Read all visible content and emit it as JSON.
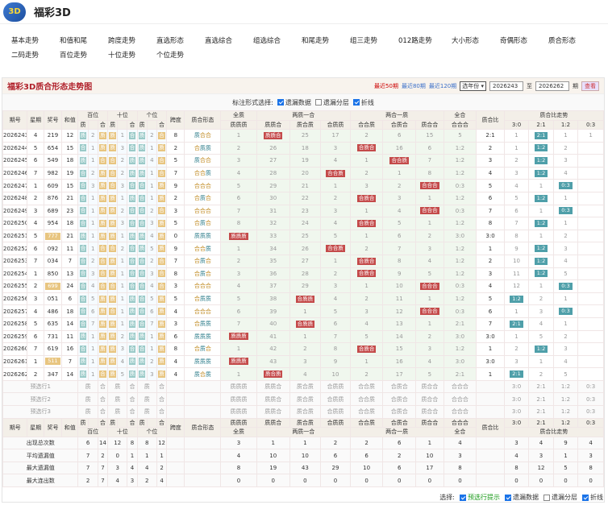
{
  "app": {
    "title": "福彩3D",
    "logo_icon": "fc3d-logo-icon"
  },
  "nav": [
    "基本走势",
    "和值和尾",
    "跨度走势",
    "直选形态",
    "直选综合",
    "组选综合",
    "和尾走势",
    "组三走势",
    "012路走势",
    "大小形态",
    "奇偶形态",
    "质合形态",
    "二码走势",
    "百位走势",
    "十位走势",
    "个位走势"
  ],
  "panel": {
    "title": "福彩3D质合形态走势图",
    "recent50": "最近50期",
    "recent80": "最近80期",
    "recent120": "最近120期",
    "year_select": "选年份",
    "from": "2026243",
    "to_label": "至",
    "to": "2026262",
    "period": "期",
    "query": "查看"
  },
  "options": {
    "label": "标注形式选择:",
    "items": [
      {
        "label": "遗漏数据",
        "checked": true
      },
      {
        "label": "遗漏分层",
        "checked": false
      },
      {
        "label": "折线",
        "checked": true
      }
    ]
  },
  "headers": {
    "qh": "期号",
    "xq": "星期",
    "jh": "奖号",
    "hz": "和值",
    "bw": "百位",
    "sw": "十位",
    "gw": "个位",
    "kd": "跨度",
    "zhxt": "质合形态",
    "qz": "全质",
    "lzyh": "两质一合",
    "lhyz": "两合一质",
    "qh2": "全合",
    "zhb": "质合比",
    "zhbzs": "质合比走势",
    "zz": "质",
    "hh": "合",
    "qzz": "质质质",
    "zzh": "质质合",
    "zhz": "质合质",
    "hzz": "合质质",
    "hhz": "合合质",
    "hzh": "合质合",
    "zhh": "质合合",
    "hhh": "合合合",
    "r30": "3:0",
    "r21": "2:1",
    "r12": "1:2",
    "r03": "0:3"
  },
  "rows": [
    [
      "2026243",
      "4",
      "219",
      "12",
      [
        "质",
        2,
        "质"
      ],
      [
        "质",
        1,
        "合"
      ],
      [
        "质",
        2,
        "合"
      ],
      "8",
      "质合合",
      1,
      "质质合",
      25,
      17,
      2,
      6,
      15,
      5,
      "2:1",
      1,
      "2:1",
      1,
      1
    ],
    [
      "2026244",
      "5",
      "654",
      "15",
      [
        "合",
        1,
        "质"
      ],
      [
        "质",
        3,
        "合"
      ],
      [
        "质",
        1,
        "质"
      ],
      "2",
      "合质质",
      2,
      26,
      18,
      3,
      "合质合",
      16,
      6,
      "1:2",
      2,
      1,
      "1:2",
      2
    ],
    [
      "2026245",
      "6",
      "549",
      "18",
      [
        "质",
        1,
        "合"
      ],
      [
        "合",
        2,
        "质"
      ],
      [
        "质",
        4,
        "合"
      ],
      "5",
      "质合合",
      3,
      27,
      19,
      4,
      1,
      "合合质",
      7,
      "1:2",
      3,
      2,
      "1:2",
      3
    ],
    [
      "2026246",
      "7",
      "982",
      "19",
      [
        "合",
        2,
        "质"
      ],
      [
        "合",
        2,
        "质"
      ],
      [
        "质",
        1,
        "合"
      ],
      "7",
      "合合质",
      4,
      28,
      20,
      "合合质",
      2,
      1,
      8,
      "1:2",
      4,
      3,
      "1:2",
      4
    ],
    [
      "2026247",
      "1",
      "609",
      "15",
      [
        "合",
        3,
        "质"
      ],
      [
        "合",
        3,
        "合"
      ],
      [
        "合",
        1,
        "质"
      ],
      "9",
      "合合合",
      5,
      29,
      21,
      1,
      3,
      2,
      "合合合",
      "0:3",
      5,
      4,
      1,
      "0:3"
    ],
    [
      "2026248",
      "2",
      "876",
      "21",
      [
        "合",
        1,
        "质"
      ],
      [
        "质",
        1,
        "质"
      ],
      [
        "合",
        1,
        "质"
      ],
      "2",
      "合质合",
      6,
      30,
      22,
      2,
      "合质合",
      3,
      1,
      "1:2",
      6,
      5,
      "1:2",
      1
    ],
    [
      "2026249",
      "3",
      "689",
      "23",
      [
        "合",
        1,
        "质"
      ],
      [
        "质",
        2,
        "合"
      ],
      [
        "合",
        2,
        "合"
      ],
      "3",
      "合合合",
      7,
      31,
      23,
      3,
      1,
      4,
      "合合合",
      "0:3",
      7,
      6,
      1,
      "0:3"
    ],
    [
      "2026250",
      "4",
      "954",
      "18",
      [
        "合",
        1,
        "质"
      ],
      [
        "质",
        3,
        "合"
      ],
      [
        "合",
        3,
        "质"
      ],
      "5",
      "合质合",
      8,
      32,
      24,
      4,
      "合质合",
      5,
      1,
      "1:2",
      8,
      7,
      "1:2",
      1
    ],
    [
      "2026251",
      "5",
      "777",
      "21",
      [
        "质",
        1,
        "质"
      ],
      [
        "质",
        1,
        "质"
      ],
      [
        "质",
        4,
        "质"
      ],
      "0",
      "质质质",
      "质质质",
      33,
      25,
      5,
      1,
      6,
      2,
      "3:0",
      "3:0",
      8,
      1,
      2
    ],
    [
      "2026252",
      "6",
      "092",
      "11",
      [
        "合",
        1,
        "合"
      ],
      [
        "合",
        2,
        "合"
      ],
      [
        "质",
        5,
        "质"
      ],
      "9",
      "合合质",
      1,
      34,
      26,
      "合合质",
      2,
      7,
      3,
      "1:2",
      1,
      9,
      "1:2",
      3
    ],
    [
      "2026253",
      "7",
      "034",
      "7",
      [
        "合",
        2,
        "合"
      ],
      [
        "质",
        1,
        "合"
      ],
      [
        "合",
        2,
        "合"
      ],
      "7",
      "合质合",
      2,
      35,
      27,
      1,
      "合质合",
      8,
      4,
      "1:2",
      2,
      10,
      "1:2",
      4
    ],
    [
      "2026254",
      "1",
      "850",
      "13",
      [
        "合",
        3,
        "合"
      ],
      [
        "质",
        1,
        "合"
      ],
      [
        "合",
        3,
        "合"
      ],
      "8",
      "合质合",
      3,
      36,
      28,
      2,
      "合质合",
      9,
      5,
      "1:2",
      3,
      11,
      "1:2",
      5
    ],
    [
      "2026255",
      "2",
      "699",
      "24",
      [
        "合",
        4,
        "合"
      ],
      [
        "合",
        1,
        "合"
      ],
      [
        "合",
        4,
        "合"
      ],
      "3",
      "合合合",
      4,
      37,
      29,
      3,
      1,
      10,
      "合合合",
      "0:3",
      4,
      12,
      1,
      "0:3"
    ],
    [
      "2026256",
      "3",
      "051",
      "6",
      [
        "合",
        5,
        "质"
      ],
      [
        "质",
        1,
        "质"
      ],
      [
        "合",
        5,
        "质"
      ],
      "5",
      "合质质",
      5,
      38,
      "合质质",
      4,
      2,
      11,
      1,
      "1:2",
      5,
      "1:2",
      2,
      1
    ],
    [
      "2026257",
      "4",
      "486",
      "18",
      [
        "合",
        6,
        "质"
      ],
      [
        "合",
        1,
        "质"
      ],
      [
        "合",
        6,
        "质"
      ],
      "4",
      "合合合",
      6,
      39,
      1,
      5,
      3,
      12,
      "合合合",
      "0:3",
      6,
      1,
      3,
      "0:3"
    ],
    [
      "2026258",
      "5",
      "635",
      "14",
      [
        "合",
        7,
        "质"
      ],
      [
        "质",
        1,
        "质"
      ],
      [
        "合",
        7,
        "质"
      ],
      "3",
      "合质质",
      7,
      40,
      "合质质",
      6,
      4,
      13,
      1,
      "2:1",
      7,
      "2:1",
      4,
      1
    ],
    [
      "2026259",
      "6",
      "731",
      "11",
      [
        "质",
        1,
        "质"
      ],
      [
        "质",
        2,
        "质"
      ],
      [
        "质",
        1,
        "质"
      ],
      "6",
      "质质质",
      "质质质",
      41,
      1,
      7,
      5,
      14,
      2,
      "3:0",
      "3:0",
      1,
      5,
      2
    ],
    [
      "2026260",
      "7",
      "619",
      "16",
      [
        "合",
        1,
        "质"
      ],
      [
        "质",
        3,
        "合"
      ],
      [
        "合",
        1,
        "质"
      ],
      "8",
      "合质合",
      1,
      42,
      2,
      8,
      "合质合",
      15,
      3,
      "1:2",
      1,
      2,
      "1:2",
      3
    ],
    [
      "2026261",
      "1",
      "511",
      "7",
      [
        "质",
        1,
        "质"
      ],
      [
        "质",
        4,
        "质"
      ],
      [
        "质",
        2,
        "质"
      ],
      "4",
      "质质质",
      "质质质",
      43,
      3,
      9,
      1,
      16,
      4,
      "3:0",
      "3:0",
      3,
      1,
      4
    ],
    [
      "2026262",
      "2",
      "347",
      "14",
      [
        "质",
        1,
        "合"
      ],
      [
        "质",
        5,
        "质"
      ],
      [
        "质",
        3,
        "质"
      ],
      "4",
      "质合质",
      1,
      "质合质",
      4,
      10,
      2,
      17,
      5,
      "2:1",
      1,
      "2:1",
      2,
      5
    ]
  ],
  "forecast": [
    "预选行1",
    "预选行2",
    "预选行3"
  ],
  "stats": [
    {
      "label": "出现总次数",
      "vals": [
        "6",
        "14",
        "12",
        "8",
        "8",
        "12",
        "",
        "3",
        "1",
        "1",
        "2",
        "2",
        "6",
        "1",
        "4",
        "",
        "3",
        "4",
        "9",
        "4"
      ]
    },
    {
      "label": "平均遗漏值",
      "vals": [
        "7",
        "2",
        "0",
        "1",
        "1",
        "1",
        "",
        "4",
        "10",
        "10",
        "6",
        "6",
        "2",
        "10",
        "3",
        "",
        "4",
        "3",
        "1",
        "3"
      ]
    },
    {
      "label": "最大遗漏值",
      "vals": [
        "7",
        "7",
        "3",
        "4",
        "4",
        "2",
        "",
        "8",
        "19",
        "43",
        "29",
        "10",
        "6",
        "17",
        "8",
        "",
        "8",
        "12",
        "5",
        "8"
      ]
    },
    {
      "label": "最大连出数",
      "vals": [
        "2",
        "7",
        "4",
        "3",
        "2",
        "4",
        "",
        "0",
        "0",
        "0",
        "0",
        "0",
        "0",
        "0",
        "0",
        "",
        "0",
        "0",
        "0",
        "0"
      ]
    }
  ],
  "footer": {
    "label": "选择:",
    "items": [
      {
        "label": "预选行提示",
        "checked": true
      },
      {
        "label": "遗漏数据",
        "checked": true
      },
      {
        "label": "遗漏分层",
        "checked": false
      },
      {
        "label": "折线",
        "checked": true
      }
    ]
  }
}
